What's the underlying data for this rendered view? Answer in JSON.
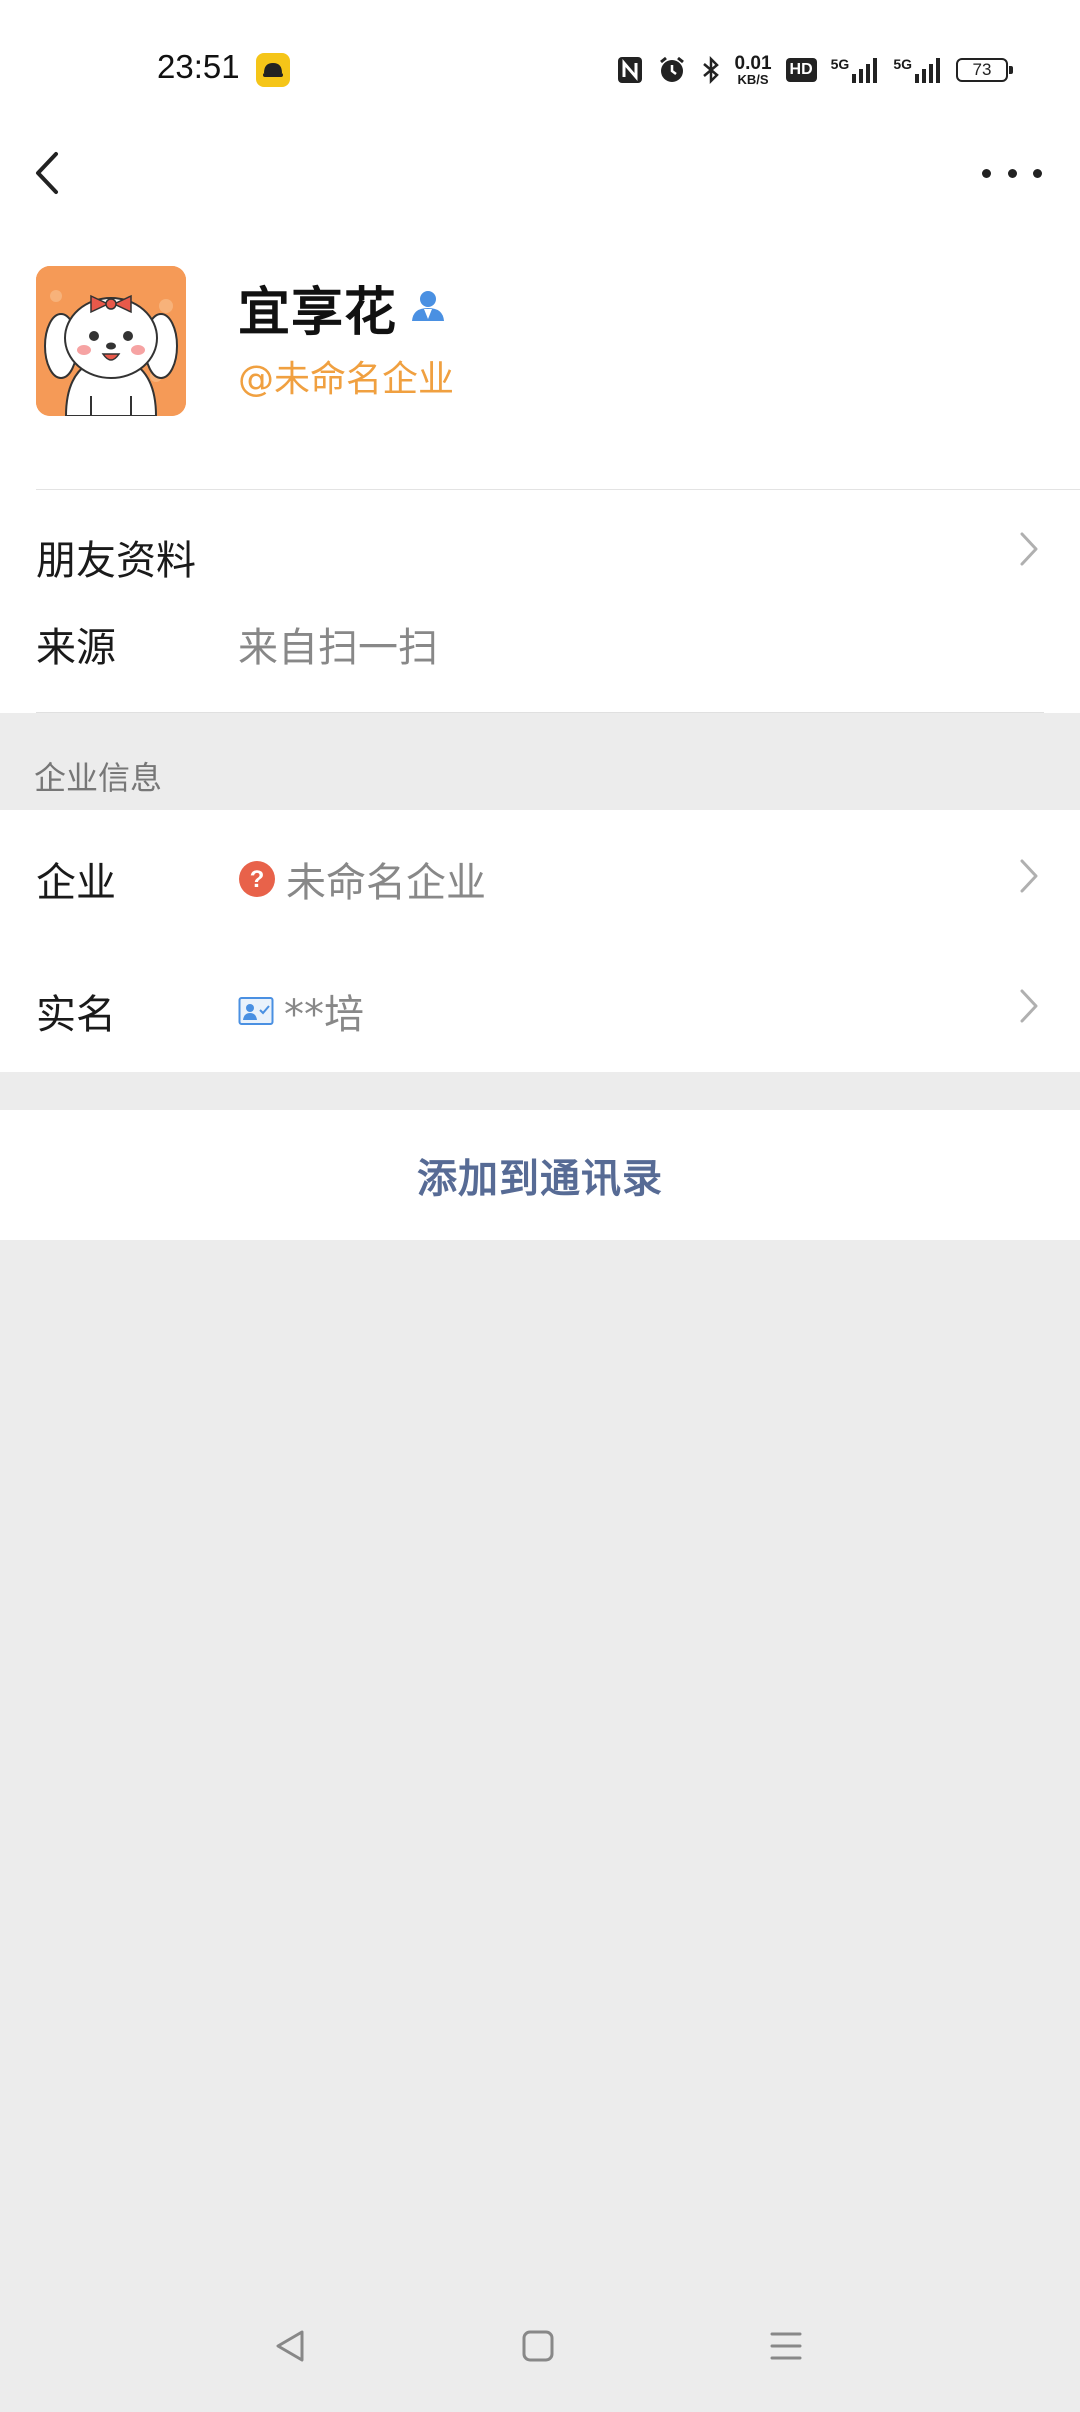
{
  "status_bar": {
    "time": "23:51",
    "net_speed_value": "0.01",
    "net_speed_unit": "KB/S",
    "hd_label": "HD",
    "network_1": "5G",
    "network_2": "5G",
    "battery": "73",
    "icons": [
      "app-icon",
      "nfc-icon",
      "alarm-icon",
      "bluetooth-icon",
      "hd-voice-icon",
      "signal-icon",
      "signal-icon",
      "battery-icon"
    ]
  },
  "nav": {
    "back_icon": "chevron-left-icon",
    "more_icon": "more-horizontal-icon"
  },
  "profile": {
    "name": "宜享花",
    "company_tag": "@未命名企业",
    "name_badge_icon": "person-icon"
  },
  "friend_info": {
    "label": "朋友资料",
    "source_label": "来源",
    "source_value": "来自扫一扫"
  },
  "enterprise": {
    "section_title": "企业信息",
    "company_label": "企业",
    "company_value": "未命名企业",
    "company_icon": "question-icon",
    "realname_label": "实名",
    "realname_value": "**培",
    "realname_icon": "id-card-icon"
  },
  "actions": {
    "add_to_contacts": "添加到通讯录"
  },
  "system_nav": {
    "icons": [
      "back-triangle-icon",
      "home-square-icon",
      "recents-menu-icon"
    ]
  },
  "colors": {
    "accent_orange": "#f0a040",
    "link_blue": "#576b95",
    "background_gray": "#ececec",
    "question_red": "#e8624a",
    "person_blue": "#4a90e2"
  }
}
